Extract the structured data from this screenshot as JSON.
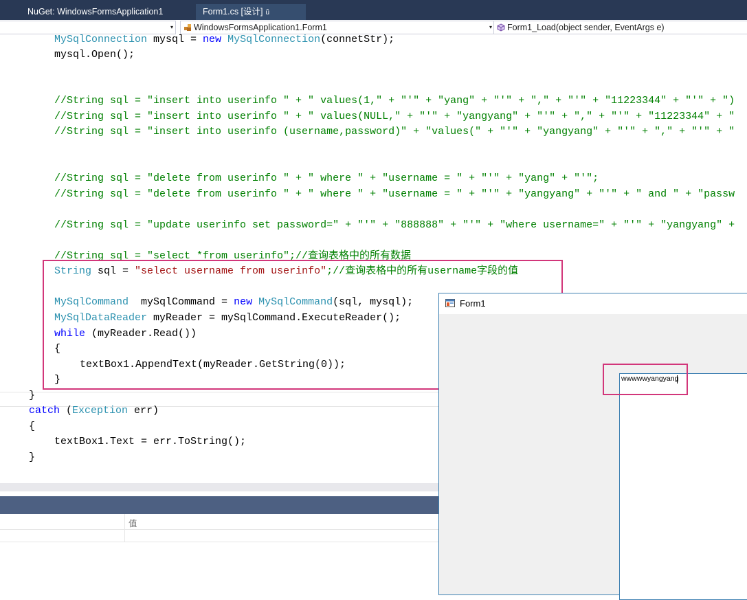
{
  "tabs": [
    {
      "label": "NuGet: WindowsFormsApplication1"
    },
    {
      "label": "Form1.cs [设计]",
      "pin": "ǖ"
    }
  ],
  "navbar": {
    "project": "",
    "class_name": "WindowsFormsApplication1.Form1",
    "member": "Form1_Load(object sender, EventArgs e)",
    "dropdown_arrow": "▾"
  },
  "code": {
    "l1": {
      "t1": "MySqlConnection",
      "t2": " mysql = ",
      "kw": "new",
      "t3": " ",
      "t4": "MySqlConnection",
      "t5": "(connetStr);"
    },
    "l2": "mysql.Open();",
    "l3": "//String sql = \"insert into userinfo \" + \" values(1,\" + \"'\" + \"yang\" + \"'\" + \",\" + \"'\" + \"11223344\" + \"'\" + \")",
    "l4": "//String sql = \"insert into userinfo \" + \" values(NULL,\" + \"'\" + \"yangyang\" + \"'\" + \",\" + \"'\" + \"11223344\" + \"",
    "l5": "//String sql = \"insert into userinfo (username,password)\" + \"values(\" + \"'\" + \"yangyang\" + \"'\" + \",\" + \"'\" + \"",
    "l6": "//String sql = \"delete from userinfo \" + \" where \" + \"username = \" + \"'\" + \"yang\" + \"'\";",
    "l7": "//String sql = \"delete from userinfo \" + \" where \" + \"username = \" + \"'\" + \"yangyang\" + \"'\" + \" and \" + \"passw",
    "l8": "//String sql = \"update userinfo set password=\" + \"'\" + \"888888\" + \"'\" + \"where username=\" + \"'\" + \"yangyang\" +",
    "l9": "//String sql = \"select *from userinfo\";//查询表格中的所有数据",
    "l10": {
      "t1": "String",
      "t2": " sql = ",
      "t3": "\"select username from userinfo\"",
      "t4": ";//查询表格中的所有username字段的值"
    },
    "l11": {
      "t1": "MySqlCommand",
      "t2": "  mySqlCommand = ",
      "kw": "new",
      "t3": " ",
      "t4": "MySqlCommand",
      "t5": "(sql, mysql);"
    },
    "l12": {
      "t1": "MySqlDataReader",
      "t2": " myReader = mySqlCommand.ExecuteReader();"
    },
    "l13": {
      "kw": "while",
      "t2": " (myReader.Read())"
    },
    "l14": "{",
    "l15": "textBox1.AppendText(myReader.GetString(0));",
    "l16": "}",
    "l17": "}",
    "l18": {
      "kw": "catch",
      "t2": " (",
      "t3": "Exception",
      "t4": " err)"
    },
    "l19": "{",
    "l20": "textBox1.Text = err.ToString();",
    "l21": "}"
  },
  "output_panel": {
    "value_column": "值"
  },
  "form_window": {
    "title": "Form1",
    "textbox_value": "wwwwwyangyang"
  },
  "colors": {
    "keyword": "#0000ff",
    "type": "#2b91af",
    "string": "#a31515",
    "comment": "#008000",
    "highlight_box": "#d2367a",
    "tab_bar": "#293955"
  }
}
